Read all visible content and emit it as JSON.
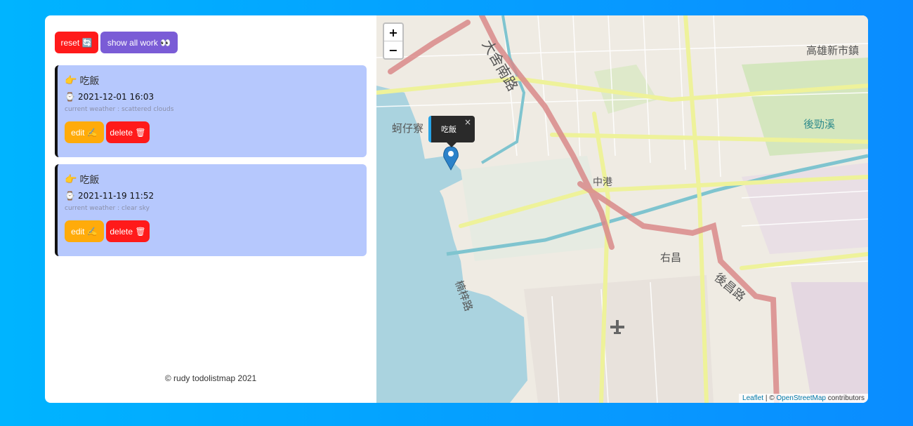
{
  "toolbar": {
    "reset_label": "reset",
    "reset_icon": "🔄",
    "show_all_label": "show all work",
    "show_all_icon": "👀"
  },
  "tasks": [
    {
      "title": "吃飯",
      "datetime": "2021-12-01 16:03",
      "weather": "current weather : scattered clouds",
      "edit_label": "edit",
      "delete_label": "delete"
    },
    {
      "title": "吃飯",
      "datetime": "2021-11-19 11:52",
      "weather": "current weather : clear sky",
      "edit_label": "edit",
      "delete_label": "delete"
    }
  ],
  "footer": "© rudy todolistmap 2021",
  "map": {
    "zoom_in": "+",
    "zoom_out": "−",
    "popup_text": "吃飯",
    "popup_close": "×",
    "attribution": {
      "leaflet": "Leaflet",
      "sep": " | © ",
      "osm": "OpenStreetMap",
      "suffix": " contributors"
    },
    "labels": [
      "大舍南路",
      "蚵仔寮",
      "後勁溪",
      "高雄新市鎮",
      "中港",
      "右昌",
      "後昌路",
      "楠梓路"
    ]
  },
  "colors": {
    "background_start": "#00b4ff",
    "background_end": "#0a8cff",
    "task_card": "#b6c8fd",
    "reset": "#ff1a1a",
    "show_all": "#7a5cd6",
    "edit": "#ffab0a",
    "delete": "#ff1a1a",
    "popup_accent": "#27a3e6"
  }
}
